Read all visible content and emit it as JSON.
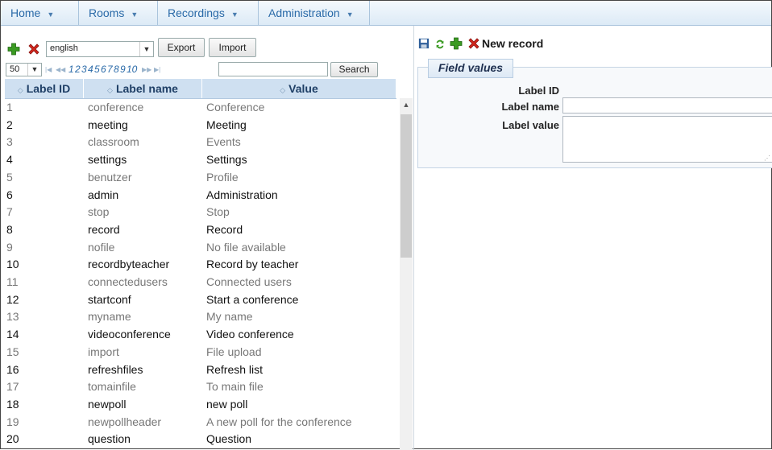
{
  "menu": {
    "items": [
      {
        "label": "Home"
      },
      {
        "label": "Rooms"
      },
      {
        "label": "Recordings"
      },
      {
        "label": "Administration"
      }
    ]
  },
  "toolbar": {
    "language": "english",
    "export_label": "Export",
    "import_label": "Import"
  },
  "pager": {
    "page_size": "50",
    "pages": [
      "1",
      "2",
      "3",
      "4",
      "5",
      "6",
      "7",
      "8",
      "9",
      "10"
    ],
    "search_label": "Search",
    "search_value": ""
  },
  "grid": {
    "headers": [
      "Label ID",
      "Label name",
      "Value"
    ],
    "rows": [
      {
        "id": "1",
        "name": "conference",
        "value": "Conference"
      },
      {
        "id": "2",
        "name": "meeting",
        "value": "Meeting"
      },
      {
        "id": "3",
        "name": "classroom",
        "value": "Events"
      },
      {
        "id": "4",
        "name": "settings",
        "value": "Settings"
      },
      {
        "id": "5",
        "name": "benutzer",
        "value": "Profile"
      },
      {
        "id": "6",
        "name": "admin",
        "value": "Administration"
      },
      {
        "id": "7",
        "name": "stop",
        "value": "Stop"
      },
      {
        "id": "8",
        "name": "record",
        "value": "Record"
      },
      {
        "id": "9",
        "name": "nofile",
        "value": "No file available"
      },
      {
        "id": "10",
        "name": "recordbyteacher",
        "value": "Record by teacher"
      },
      {
        "id": "11",
        "name": "connectedusers",
        "value": "Connected users"
      },
      {
        "id": "12",
        "name": "startconf",
        "value": "Start a conference"
      },
      {
        "id": "13",
        "name": "myname",
        "value": "My name"
      },
      {
        "id": "14",
        "name": "videoconference",
        "value": "Video conference"
      },
      {
        "id": "15",
        "name": "import",
        "value": "File upload"
      },
      {
        "id": "16",
        "name": "refreshfiles",
        "value": "Refresh list"
      },
      {
        "id": "17",
        "name": "tomainfile",
        "value": "To main file"
      },
      {
        "id": "18",
        "name": "newpoll",
        "value": "new poll"
      },
      {
        "id": "19",
        "name": "newpollheader",
        "value": "A new poll for the conference"
      },
      {
        "id": "20",
        "name": "question",
        "value": "Question"
      }
    ]
  },
  "form": {
    "new_record_label": "New record",
    "legend": "Field values",
    "label_id": "Label ID",
    "label_name": "Label name",
    "label_value": "Label value",
    "name_value": "",
    "value_value": ""
  },
  "colors": {
    "accent": "#2a6aa8",
    "header_bg": "#cfe0f1",
    "add_green": "#3a9a22",
    "delete_red": "#d2261c"
  },
  "icons": {
    "add": "plus-icon",
    "delete": "x-icon",
    "save": "floppy-icon",
    "refresh": "refresh-icon"
  }
}
